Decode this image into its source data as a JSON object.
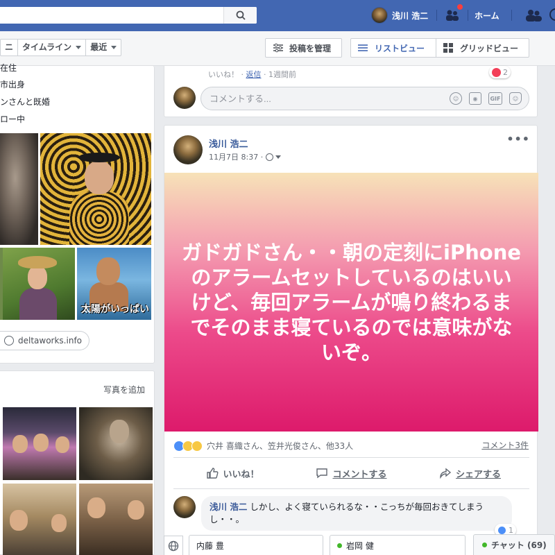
{
  "topbar": {
    "search_placeholder": "",
    "profile_name": "浅川 浩二",
    "home_label": "ホーム"
  },
  "timeline_nav": {
    "tabs": [
      {
        "label": "ニ"
      },
      {
        "label": "タイムライン"
      },
      {
        "label": "最近"
      }
    ],
    "manage_posts": "投稿を管理",
    "list_view": "リストビュー",
    "grid_view": "グリッドビュー"
  },
  "intro": {
    "lines": [
      "在住",
      "市出身",
      "ンさんと既婚",
      "ロー中"
    ],
    "website": "deltaworks.info"
  },
  "photos_section": {
    "add_photos": "写真を追加"
  },
  "previous_post": {
    "like": "いいね！",
    "reply": "返信",
    "time": "1週間前",
    "reaction_count": "2",
    "comment_placeholder": "コメントする..."
  },
  "post": {
    "author": "浅川 浩二",
    "timestamp": "11月7日 8:37",
    "text": "ガドガドさん・・朝の定刻にiPhoneのアラームセットしているのはいいけど、毎回アラームが鳴り終わるまでそのまま寝ているのでは意味がないぞ。",
    "reactors": "穴井 喜織さん、笠井光俊さん、他33人",
    "comment_count": "コメント3件",
    "actions": {
      "like": "いいね！",
      "comment": "コメントする",
      "share": "シェアする"
    },
    "colors": {
      "gradient_top": "#f7e2b8",
      "gradient_bottom": "#dd1a6b"
    }
  },
  "comment": {
    "author": "浅川 浩二",
    "text": "しかし、よく寝ていられるな・・こっちが毎回おきてしまうし・・。",
    "reaction_count": "1"
  },
  "chat_dock": {
    "tabs": [
      "内藤 豊",
      "岩岡 健"
    ],
    "chat_label": "チャット (69)"
  },
  "icons": [
    "search-icon",
    "friends-icon",
    "home-icon",
    "filter-icon",
    "list-icon",
    "grid-icon",
    "globe-icon",
    "smiley-icon",
    "camera-icon",
    "gif-icon",
    "sticker-icon",
    "more-icon",
    "like-icon",
    "comment-icon",
    "share-icon"
  ],
  "brand_color": "#4267b2"
}
